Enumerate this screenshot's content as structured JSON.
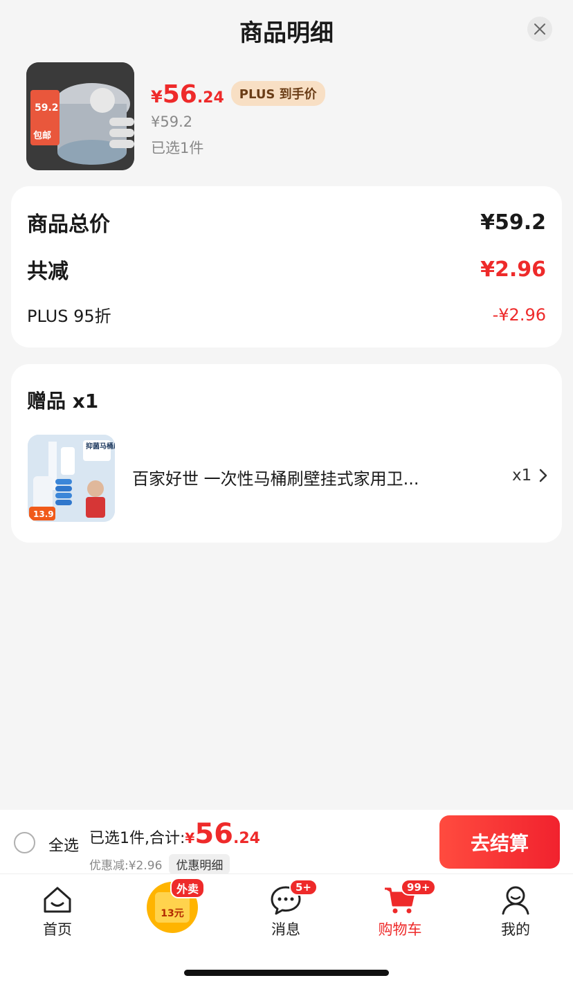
{
  "sheet": {
    "title": "商品明细"
  },
  "product": {
    "price_symbol": "¥",
    "price_integer": "56",
    "price_decimal": ".24",
    "plus_tag": "PLUS 到手价",
    "original_price": "¥59.2",
    "selected_count": "已选1件",
    "thumb_label": "59.2",
    "thumb_badge": "包邮"
  },
  "summary": {
    "total_label": "商品总价",
    "total_value": "¥59.2",
    "discount_label": "共减",
    "discount_value": "¥2.96",
    "plus_label": "PLUS 95折",
    "plus_value": "-¥2.96"
  },
  "gift": {
    "title": "赠品 x1",
    "name": "百家好世 一次性马桶刷壁挂式家用卫...",
    "quantity": "x1",
    "thumb_label": "抑菌马桶刷",
    "thumb_price": "13.9"
  },
  "checkout": {
    "select_all": "全选",
    "total_label": "已选1件,合计:",
    "total_symbol": "¥",
    "total_integer": "56",
    "total_decimal": ".24",
    "discount_text": "优惠减:¥2.96",
    "discount_detail": "优惠明细",
    "button": "去结算"
  },
  "tabbar": {
    "home": "首页",
    "promo_badge": "外卖",
    "promo_label": "13元",
    "messages": "消息",
    "messages_badge": "5+",
    "cart": "购物车",
    "cart_badge": "99+",
    "mine": "我的"
  },
  "colors": {
    "accent": "#ee2a2a",
    "plus_tag_bg": "#f8dfc4"
  }
}
